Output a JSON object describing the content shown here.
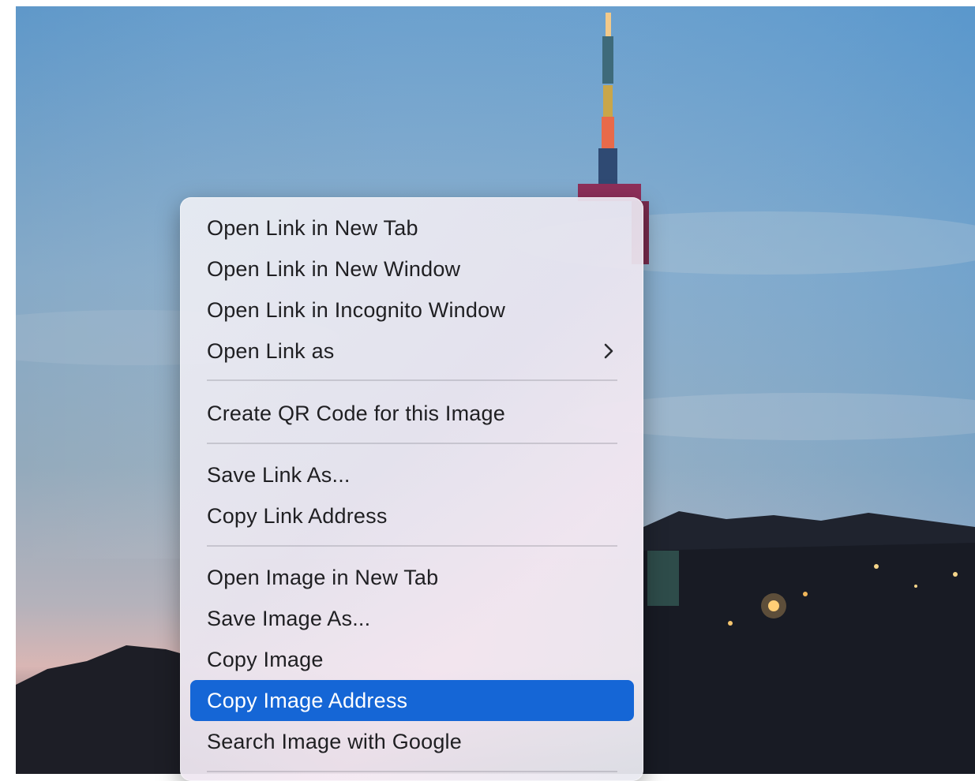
{
  "context_menu": {
    "items": [
      {
        "label": "Open Link in New Tab"
      },
      {
        "label": "Open Link in New Window"
      },
      {
        "label": "Open Link in Incognito Window"
      },
      {
        "label": "Open Link as",
        "submenu_icon": "chevron-right-icon"
      },
      {
        "label": "Create QR Code for this Image"
      },
      {
        "label": "Save Link As..."
      },
      {
        "label": "Copy Link Address"
      },
      {
        "label": "Open Image in New Tab"
      },
      {
        "label": "Save Image As..."
      },
      {
        "label": "Copy Image"
      },
      {
        "label": "Copy Image Address",
        "selected": true
      },
      {
        "label": "Search Image with Google"
      }
    ],
    "selection_color": "#1566d6"
  },
  "background": {
    "sky_colors": [
      "#6fa4cf",
      "#9fbbd3",
      "#d9b7b8"
    ]
  }
}
